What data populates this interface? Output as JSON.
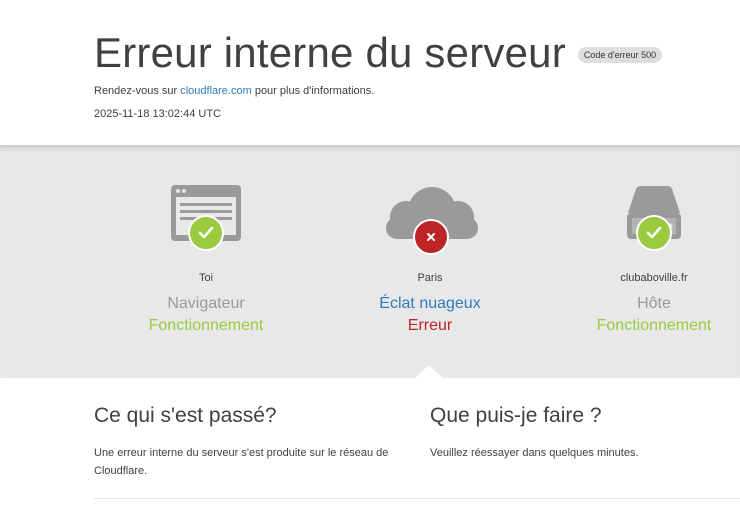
{
  "header": {
    "title": "Erreur interne du serveur",
    "error_badge": "Code d'erreur 500",
    "info_prefix": "Rendez-vous sur ",
    "info_link": "cloudflare.com",
    "info_suffix": " pour plus d'informations.",
    "timestamp": "2025-11-18 13:02:44 UTC"
  },
  "status": {
    "browser": {
      "location": "Toi",
      "role": "Navigateur",
      "state": "Fonctionnement",
      "icon": "browser-icon",
      "status_icon": "checkmark-icon"
    },
    "cloudflare": {
      "location": "Paris",
      "role": "Éclat nuageux",
      "state": "Erreur",
      "icon": "cloud-icon",
      "status_icon": "x-icon"
    },
    "host": {
      "location": "clubaboville.fr",
      "role": "Hôte",
      "state": "Fonctionnement",
      "icon": "server-icon",
      "status_icon": "checkmark-icon"
    }
  },
  "sections": {
    "what_happened": {
      "heading": "Ce qui s'est passé?",
      "body": "Une erreur interne du serveur s'est produite sur le réseau de Cloudflare."
    },
    "what_can_i_do": {
      "heading": "Que puis-je faire ?",
      "body": "Veuillez réessayer dans quelques minutes."
    }
  },
  "colors": {
    "ok": "#9bca3e",
    "error": "#bd2426",
    "link": "#2f7bbf",
    "band": "#e8e8e8"
  }
}
